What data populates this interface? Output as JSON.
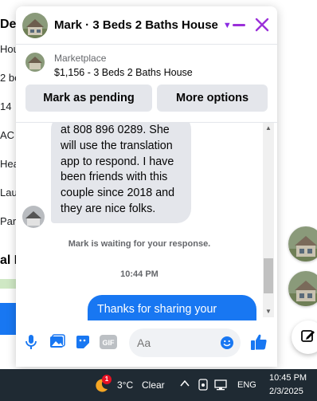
{
  "background_page": {
    "title_fragment": "De",
    "lines": [
      "Hou",
      "2 be",
      "14",
      "AC a",
      "Hea",
      "Laun",
      "Park"
    ],
    "section_heading_fragment": "al I"
  },
  "chat": {
    "contact_name": "Mark · 3 Beds 2 Baths House",
    "marketplace_label": "Marketplace",
    "listing_title": "$1,156 - 3 Beds 2 Baths House",
    "mark_pending_label": "Mark as pending",
    "more_options_label": "More options",
    "incoming_message": "at 808 896 0289. She will use the translation app to respond. I have been friends with this couple since 2018 and they are nice folks.",
    "waiting_status": "Mark is waiting for your response.",
    "timestamp": "10:44 PM",
    "outgoing_message": "Thanks for sharing your",
    "composer_placeholder": "Aa",
    "composer_gif_label": "GIF"
  },
  "taskbar": {
    "notification_count": "1",
    "temperature": "3°C",
    "condition": "Clear",
    "language": "ENG",
    "time": "10:45 PM",
    "date": "2/3/2025"
  },
  "colors": {
    "accent_purple": "#9b30d9",
    "messenger_blue": "#1877f2",
    "bubble_gray": "#e4e6eb",
    "taskbar_bg": "#1f2a33"
  },
  "icons": [
    "chevron-down-icon",
    "minimize-icon",
    "close-icon",
    "microphone-icon",
    "photo-icon",
    "sticker-icon",
    "gif-icon",
    "emoji-icon",
    "thumbs-up-icon",
    "compose-icon",
    "weather-icon",
    "chevron-up-icon",
    "network-icon",
    "display-icon"
  ]
}
